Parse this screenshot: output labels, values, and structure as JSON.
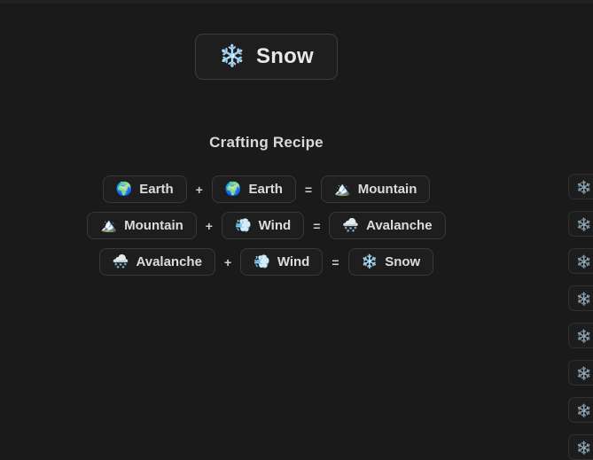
{
  "theme": {
    "background": "#1a1a1a",
    "card_background": "#1e1e1e",
    "card_border": "#383838",
    "text_primary": "#e8e8e8",
    "text_secondary": "#d9d9d9"
  },
  "result": {
    "icon": "snowflake-emoji",
    "icon_glyph": "❄️",
    "label": "Snow"
  },
  "section": {
    "title": "Crafting Recipe"
  },
  "operators": {
    "plus": "+",
    "equals": "="
  },
  "recipes": [
    {
      "input_a": {
        "icon": "earth-globe-emoji",
        "icon_glyph": "🌍",
        "label": "Earth"
      },
      "operator": "+",
      "input_b": {
        "icon": "earth-globe-emoji",
        "icon_glyph": "🌍",
        "label": "Earth"
      },
      "equals": "=",
      "output": {
        "icon": "snow-capped-mountain-emoji",
        "icon_glyph": "🏔️",
        "label": "Mountain"
      }
    },
    {
      "input_a": {
        "icon": "snow-capped-mountain-emoji",
        "icon_glyph": "🏔️",
        "label": "Mountain"
      },
      "operator": "+",
      "input_b": {
        "icon": "dashing-away-emoji",
        "icon_glyph": "💨",
        "label": "Wind"
      },
      "equals": "=",
      "output": {
        "icon": "cloud-with-snow-emoji",
        "icon_glyph": "🌨️",
        "label": "Avalanche"
      }
    },
    {
      "input_a": {
        "icon": "cloud-with-snow-emoji",
        "icon_glyph": "🌨️",
        "label": "Avalanche"
      },
      "operator": "+",
      "input_b": {
        "icon": "dashing-away-emoji",
        "icon_glyph": "💨",
        "label": "Wind"
      },
      "equals": "=",
      "output": {
        "icon": "snowflake-emoji",
        "icon_glyph": "❄️",
        "label": "Snow"
      }
    }
  ],
  "right_rail": {
    "items": [
      {
        "icon": "snowflake-emoji",
        "icon_glyph": "❄️"
      },
      {
        "icon": "snowflake-emoji",
        "icon_glyph": "❄️"
      },
      {
        "icon": "snowflake-emoji",
        "icon_glyph": "❄️"
      },
      {
        "icon": "snowflake-emoji",
        "icon_glyph": "❄️"
      },
      {
        "icon": "snowflake-emoji",
        "icon_glyph": "❄️"
      },
      {
        "icon": "snowflake-emoji",
        "icon_glyph": "❄️"
      },
      {
        "icon": "snowflake-emoji",
        "icon_glyph": "❄️"
      },
      {
        "icon": "snowflake-emoji",
        "icon_glyph": "❄️"
      }
    ]
  }
}
